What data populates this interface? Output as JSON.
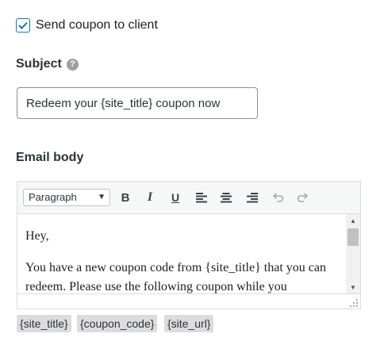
{
  "send_coupon": {
    "label": "Send coupon to client",
    "checked": true
  },
  "subject": {
    "label": "Subject",
    "help_icon_glyph": "?",
    "value": "Redeem your {site_title} coupon now"
  },
  "email_body": {
    "label": "Email body",
    "toolbar": {
      "format_select": "Paragraph",
      "buttons": [
        "bold-icon",
        "italic-icon",
        "underline-icon",
        "align-left-icon",
        "align-center-icon",
        "align-right-icon",
        "undo-icon",
        "redo-icon"
      ]
    },
    "paragraphs": [
      "Hey,",
      "You have a new coupon code from {site_title} that you can redeem. Please use the following coupon while you"
    ]
  },
  "tags": [
    "{site_title}",
    "{coupon_code}",
    "{site_url}"
  ],
  "colors": {
    "accent": "#2271b1",
    "border": "#dcdcde",
    "tag_bg": "#dcdcde"
  }
}
